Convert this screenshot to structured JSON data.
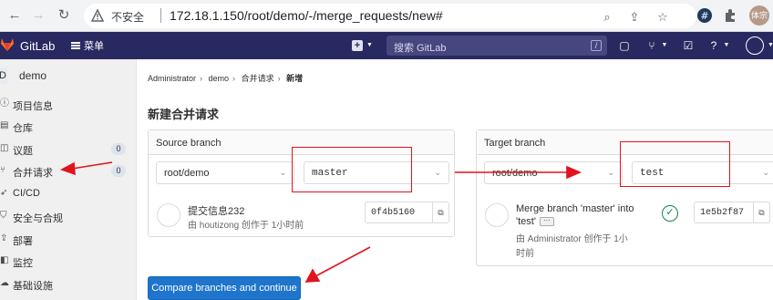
{
  "browser": {
    "insecure_label": "不安全",
    "url": "172.18.1.150/root/demo/-/merge_requests/new#",
    "profile_label": "体宗"
  },
  "topbar": {
    "brand": "GitLab",
    "menu_label": "菜单",
    "search_placeholder": "搜索 GitLab",
    "search_shortcut": "/"
  },
  "sidebar": {
    "project_initial": "D",
    "project_name": "demo",
    "items": [
      {
        "label": "项目信息",
        "icon": "info-icon"
      },
      {
        "label": "仓库",
        "icon": "doc-icon"
      },
      {
        "label": "议题",
        "icon": "issues-icon",
        "badge": "0"
      },
      {
        "label": "合并请求",
        "icon": "merge-request-icon",
        "badge": "0"
      },
      {
        "label": "CI/CD",
        "icon": "rocket-icon"
      },
      {
        "label": "安全与合规",
        "icon": "shield-icon"
      },
      {
        "label": "部署",
        "icon": "deploy-icon"
      },
      {
        "label": "监控",
        "icon": "monitor-icon"
      },
      {
        "label": "基础设施",
        "icon": "cloud-icon"
      }
    ]
  },
  "breadcrumb": [
    "Administrator",
    "demo",
    "合并请求",
    "新增"
  ],
  "page_title": "新建合并请求",
  "source": {
    "title": "Source branch",
    "project": "root/demo",
    "branch": "master",
    "commit_title": "提交信息232",
    "commit_meta": "由 houtizong 创作于 1小时前",
    "sha": "0f4b5160"
  },
  "target": {
    "title": "Target branch",
    "project": "root/demo",
    "branch": "test",
    "commit_title_line1": "Merge branch 'master' into",
    "commit_title_line2": "'test'",
    "commit_meta_line1": "由 Administrator 创作于 1小",
    "commit_meta_line2": "时前",
    "sha": "1e5b2f87"
  },
  "compare_button": "Compare branches and continue",
  "colors": {
    "topbar": "#292961",
    "primary": "#1f75cb",
    "annotation": "#e0141e",
    "success": "#108548"
  }
}
